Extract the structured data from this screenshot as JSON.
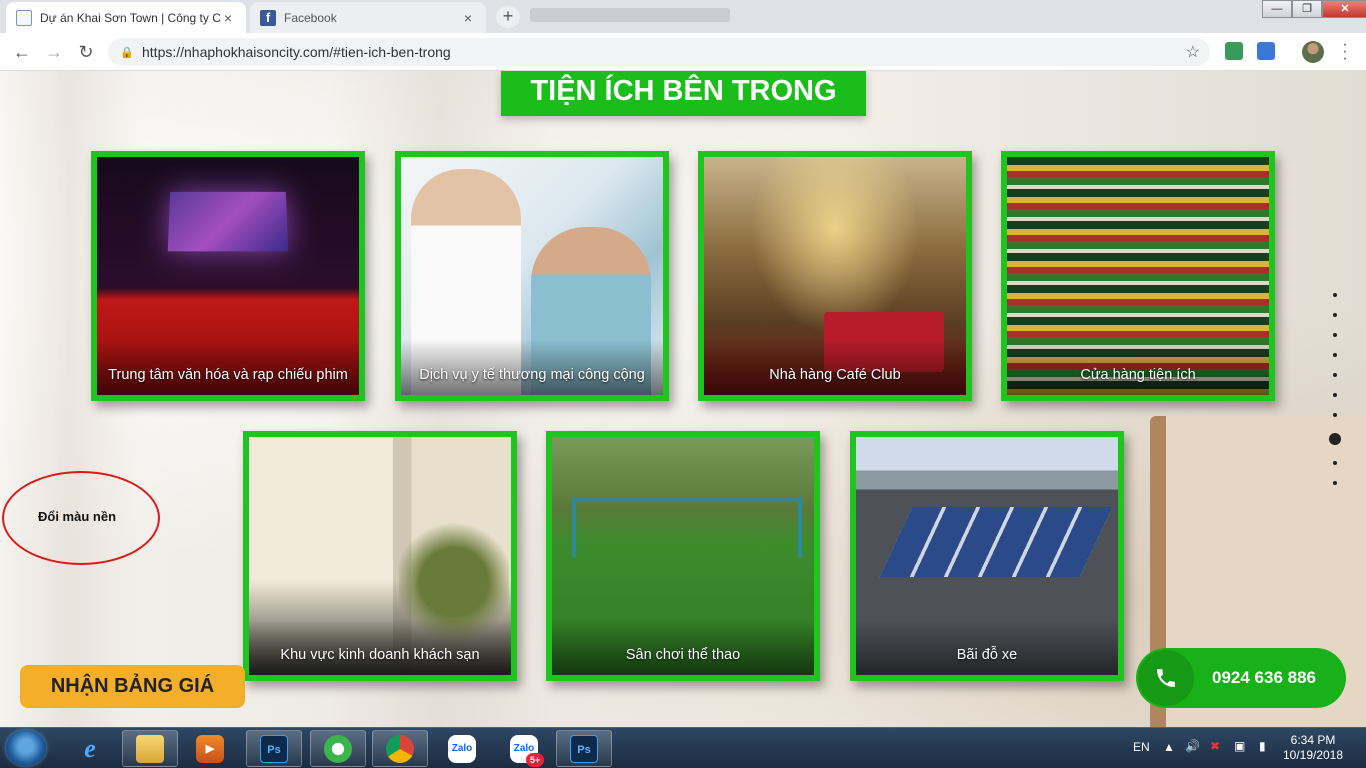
{
  "browser": {
    "tabs": [
      {
        "title": "Dự án Khai Sơn Town | Công ty C",
        "active": true,
        "icon": "page-icon"
      },
      {
        "title": "Facebook",
        "active": false,
        "icon": "facebook-icon"
      }
    ],
    "new_tab_label": "+",
    "url": "https://nhaphokhaisoncity.com/#tien-ich-ben-trong",
    "window_controls": {
      "minimize": "—",
      "maximize": "❐",
      "close": "✕"
    }
  },
  "page": {
    "section_title": "TIỆN ÍCH BÊN TRONG",
    "amenities_row1": [
      {
        "caption": "Trung tâm văn hóa và rạp chiếu phim",
        "image": "cinema"
      },
      {
        "caption": "Dịch vụ y tế thương mại công cộng",
        "image": "medical"
      },
      {
        "caption": "Nhà hàng Café Club",
        "image": "restaurant"
      },
      {
        "caption": "Cửa hàng tiện ích",
        "image": "shop"
      }
    ],
    "amenities_row2": [
      {
        "caption": "Khu vực kinh doanh khách sạn",
        "image": "hotel"
      },
      {
        "caption": "Sân chơi thể thao",
        "image": "park"
      },
      {
        "caption": "Bãi đỗ xe",
        "image": "parking"
      }
    ],
    "nav_dots": {
      "count": 10,
      "active_index": 7
    },
    "background_toggle": "Đổi màu nền",
    "price_button": "NHẬN BẢNG GIÁ",
    "phone_button": "0924 636 886",
    "colors": {
      "accent_green": "#1ec51e",
      "price_orange": "#f3ae2a",
      "annotation_red": "#e01818"
    }
  },
  "taskbar": {
    "apps": [
      "Windows Explorer",
      "Internet Explorer",
      "File Explorer",
      "Media Player",
      "Photoshop",
      "CocCoc",
      "Chrome",
      "Zalo",
      "Zalo 5+",
      "Photoshop"
    ],
    "zalo_badge": "5+",
    "ps_label": "Ps",
    "zalo_label": "Zalo",
    "language": "EN",
    "time": "6:34 PM",
    "date": "10/19/2018"
  }
}
